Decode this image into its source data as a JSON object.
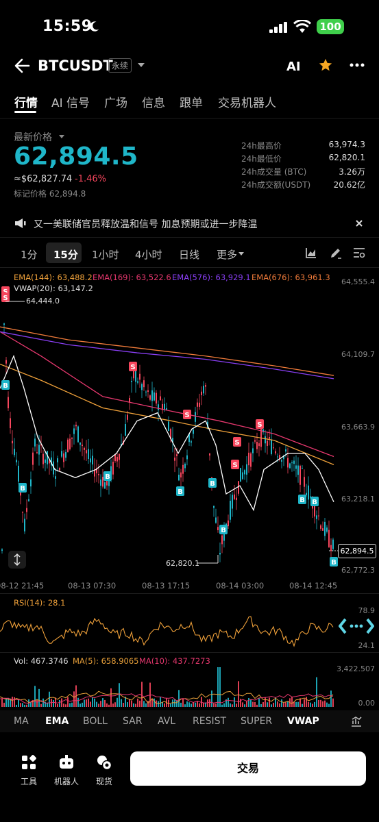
{
  "status": {
    "time": "15:59",
    "battery": "100"
  },
  "header": {
    "pair": "BTCUSDT",
    "contract_type": "永续",
    "ai_label": "AI"
  },
  "tabs": [
    "行情",
    "AI 信号",
    "广场",
    "信息",
    "跟单",
    "交易机器人"
  ],
  "price": {
    "label": "最新价格",
    "last": "62,894.5",
    "usd": "≈$62,827.74",
    "change": "-1.46%",
    "mark": "标记价格 62,894.8"
  },
  "stats": [
    {
      "label": "24h最高价",
      "value": "63,974.3"
    },
    {
      "label": "24h最低价",
      "value": "62,820.1"
    },
    {
      "label": "24h成交量 (BTC)",
      "value": "3.26万"
    },
    {
      "label": "24h成交额(USDT)",
      "value": "20.62亿"
    }
  ],
  "news": {
    "text": "又一美联储官员释放温和信号 加息预期或进一步降温"
  },
  "intervals": [
    "1分",
    "15分",
    "1小时",
    "4小时",
    "日线",
    "更多"
  ],
  "indicators_legend": {
    "ema144": "EMA(144): 63,488.2",
    "ema169": "EMA(169): 63,522.6",
    "ema576": "EMA(576): 63,929.1",
    "ema676": "EMA(676): 63,961.3",
    "vwap": "VWAP(20): 63,147.2"
  },
  "chart_axis": {
    "price_ticks": [
      "64,555.4",
      "64,109.7",
      "63,663.9",
      "63,218.1",
      "62,772.3"
    ],
    "current_price": "62,894.5",
    "high_marker": "64,444.0",
    "low_marker": "62,820.1",
    "time_ticks": [
      "08-12 21:45",
      "08-13 07:30",
      "08-13 17:15",
      "08-14 03:00",
      "08-14 12:45"
    ]
  },
  "rsi": {
    "label": "RSI(14): 28.1",
    "ticks": [
      "78.9",
      "24.1"
    ]
  },
  "volume": {
    "vol": "Vol: 467.3746",
    "ma5": "MA(5): 658.9065",
    "ma10": "MA(10): 437.7273",
    "ticks": [
      "3,422.507",
      "0.00"
    ]
  },
  "indicator_tabs": [
    "MA",
    "EMA",
    "BOLL",
    "SAR",
    "AVL",
    "RESIST",
    "SUPER",
    "VWAP"
  ],
  "bottom_nav": [
    {
      "label": "工具",
      "icon": "tools-icon"
    },
    {
      "label": "机器人",
      "icon": "robot-icon"
    },
    {
      "label": "现货",
      "icon": "spot-icon"
    }
  ],
  "trade_button": "交易",
  "colors": {
    "accent": "#1fb6c9",
    "down": "#f6465d",
    "up": "#1fb6c9",
    "ema144": "#f0a13a",
    "ema169": "#e8386f",
    "ema576": "#8a3ff5",
    "ema676": "#f07b3a"
  }
}
